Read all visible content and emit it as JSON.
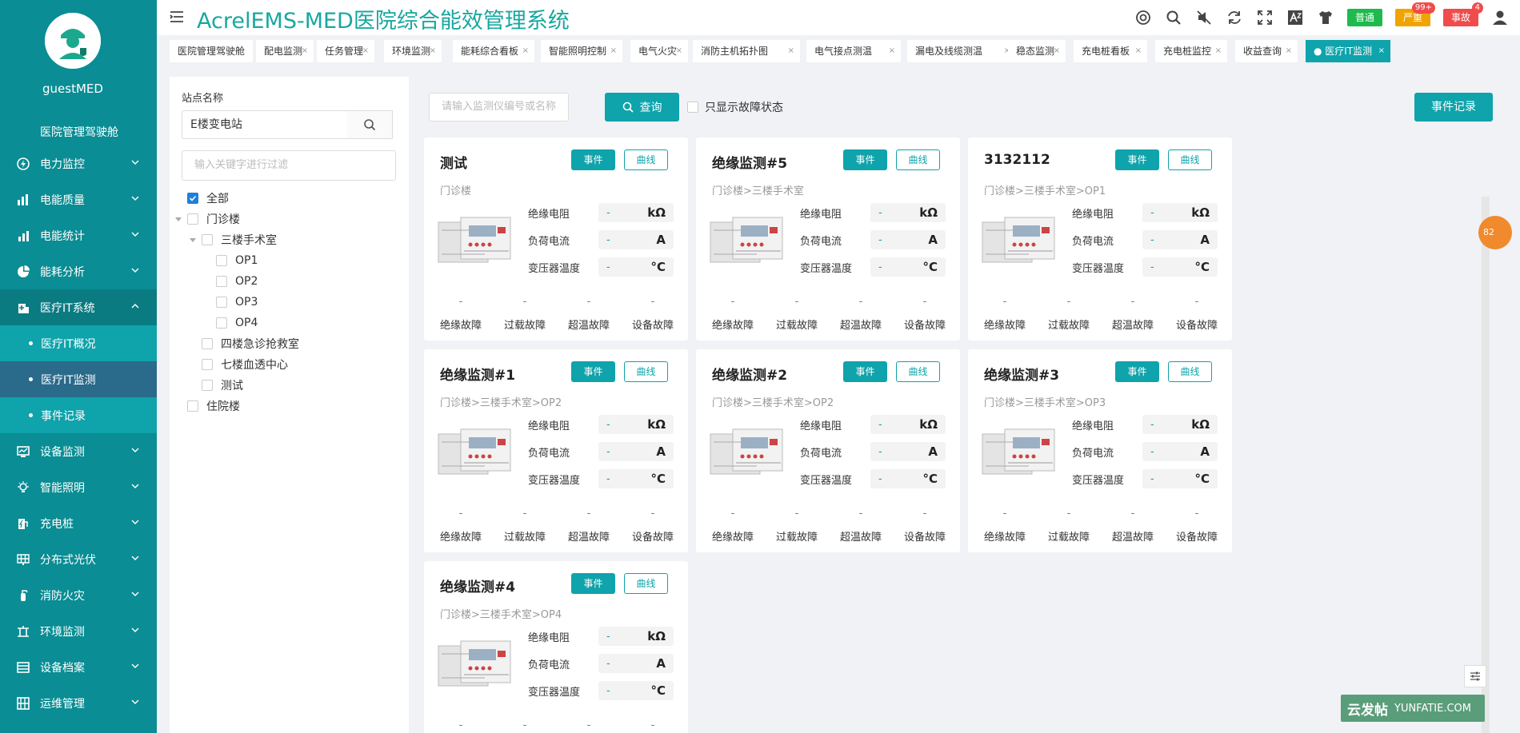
{
  "sidebar": {
    "username": "guestMED",
    "home": "医院管理驾驶舱",
    "items": [
      {
        "label": "电力监控",
        "icon": "power-monitor-icon"
      },
      {
        "label": "电能质量",
        "icon": "power-quality-icon"
      },
      {
        "label": "电能统计",
        "icon": "bar-chart-icon"
      },
      {
        "label": "能耗分析",
        "icon": "pie-chart-icon"
      },
      {
        "label": "医疗IT系统",
        "icon": "hospital-icon"
      },
      {
        "label": "设备监测",
        "icon": "device-monitor-icon"
      },
      {
        "label": "智能照明",
        "icon": "lightbulb-icon"
      },
      {
        "label": "充电桩",
        "icon": "charging-pile-icon"
      },
      {
        "label": "分布式光伏",
        "icon": "solar-panel-icon"
      },
      {
        "label": "消防火灾",
        "icon": "fire-extinguisher-icon"
      },
      {
        "label": "环境监测",
        "icon": "environment-icon"
      },
      {
        "label": "设备档案",
        "icon": "archive-icon"
      },
      {
        "label": "运维管理",
        "icon": "maintenance-icon"
      }
    ],
    "submenu": [
      {
        "label": "医疗IT概况"
      },
      {
        "label": "医疗IT监测"
      },
      {
        "label": "事件记录"
      }
    ]
  },
  "header": {
    "title": "AcrelEMS-MED医院综合能效管理系统",
    "badges": [
      {
        "label": "普通",
        "count": "",
        "color": "#1fba4e"
      },
      {
        "label": "严重",
        "count": "99+",
        "color": "#f0a400"
      },
      {
        "label": "事故",
        "count": "4",
        "color": "#f04c4c"
      }
    ]
  },
  "tabs": [
    {
      "label": "医院管理驾驶舱",
      "close": ""
    },
    {
      "label": "配电监测",
      "close": "×"
    },
    {
      "label": "任务管理",
      "close": "×"
    },
    {
      "label": "环境监测",
      "close": "×"
    },
    {
      "label": "能耗综合看板",
      "close": "×"
    },
    {
      "label": "智能照明控制",
      "close": "×"
    },
    {
      "label": "电气火灾",
      "close": "×"
    },
    {
      "label": "消防主机拓扑图",
      "close": "×"
    },
    {
      "label": "电气接点测温",
      "close": "×"
    },
    {
      "label": "漏电及线缆测温",
      "close": "×"
    },
    {
      "label": "稳态监测",
      "close": "×"
    },
    {
      "label": "充电桩看板",
      "close": "×"
    },
    {
      "label": "充电桩监控",
      "close": "×"
    },
    {
      "label": "收益查询",
      "close": "×"
    },
    {
      "label": "● 医疗IT监测",
      "close": "×"
    }
  ],
  "tree_panel": {
    "site_label": "站点名称",
    "site_value": "E楼变电站",
    "filter_placeholder": "输入关键字进行过滤",
    "nodes": [
      {
        "label": "全部"
      },
      {
        "label": "门诊楼"
      },
      {
        "label": "三楼手术室"
      },
      {
        "label": "OP1"
      },
      {
        "label": "OP2"
      },
      {
        "label": "OP3"
      },
      {
        "label": "OP4"
      },
      {
        "label": "四楼急诊抢救室"
      },
      {
        "label": "七楼血透中心"
      },
      {
        "label": "测试"
      },
      {
        "label": "住院楼"
      }
    ]
  },
  "main": {
    "search_placeholder": "请输入监测仪编号或名称",
    "query_label": "查询",
    "fault_only_label": "只显示故障状态",
    "event_log_label": "事件记录",
    "event_btn": "事件",
    "curve_btn": "曲线",
    "metric_labels": [
      "绝缘电阻",
      "负荷电流",
      "变压器温度"
    ],
    "metric_units": [
      "kΩ",
      "A",
      "°C"
    ],
    "fault_labels": [
      "绝缘故障",
      "过载故障",
      "超温故障",
      "设备故障"
    ],
    "cards": [
      {
        "title": "测试",
        "path": "门诊楼",
        "values": [
          "-",
          "-",
          "-"
        ],
        "faults": [
          "-",
          "-",
          "-",
          "-"
        ]
      },
      {
        "title": "绝缘监测#5",
        "path": "门诊楼>三楼手术室",
        "values": [
          "-",
          "-",
          "-"
        ],
        "faults": [
          "-",
          "-",
          "-",
          "-"
        ]
      },
      {
        "title": "3132112",
        "path": "门诊楼>三楼手术室>OP1",
        "values": [
          "-",
          "-",
          "-"
        ],
        "faults": [
          "-",
          "-",
          "-",
          "-"
        ]
      },
      {
        "title": "绝缘监测#1",
        "path": "门诊楼>三楼手术室>OP2",
        "values": [
          "-",
          "-",
          "-"
        ],
        "faults": [
          "-",
          "-",
          "-",
          "-"
        ]
      },
      {
        "title": "绝缘监测#2",
        "path": "门诊楼>三楼手术室>OP2",
        "values": [
          "-",
          "-",
          "-"
        ],
        "faults": [
          "-",
          "-",
          "-",
          "-"
        ]
      },
      {
        "title": "绝缘监测#3",
        "path": "门诊楼>三楼手术室>OP3",
        "values": [
          "-",
          "-",
          "-"
        ],
        "faults": [
          "-",
          "-",
          "-",
          "-"
        ]
      },
      {
        "title": "绝缘监测#4",
        "path": "门诊楼>三楼手术室>OP4",
        "values": [
          "-",
          "-",
          "-"
        ],
        "faults": [
          "-",
          "-",
          "-",
          "-"
        ]
      }
    ],
    "float_circle": "82",
    "watermark_cn": "云发帖",
    "watermark_en": "YUNFATIE.COM"
  },
  "colors": {
    "accent": "#0fa3ab",
    "sidebar": "#0a8d94",
    "title": "#18a8a0"
  }
}
